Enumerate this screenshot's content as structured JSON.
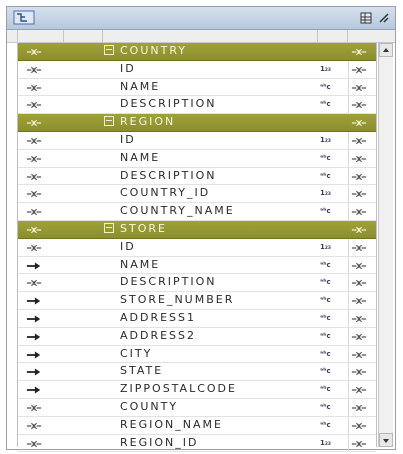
{
  "groups": [
    {
      "name": "COUNTRY",
      "fields": [
        {
          "name": "ID",
          "type": "num",
          "dir": "link"
        },
        {
          "name": "NAME",
          "type": "str",
          "dir": "link"
        },
        {
          "name": "DESCRIPTION",
          "type": "str",
          "dir": "link"
        }
      ]
    },
    {
      "name": "REGION",
      "fields": [
        {
          "name": "ID",
          "type": "num",
          "dir": "link"
        },
        {
          "name": "NAME",
          "type": "str",
          "dir": "link"
        },
        {
          "name": "DESCRIPTION",
          "type": "str",
          "dir": "link"
        },
        {
          "name": "COUNTRY_ID",
          "type": "num",
          "dir": "link"
        },
        {
          "name": "COUNTRY_NAME",
          "type": "str",
          "dir": "link"
        }
      ]
    },
    {
      "name": "STORE",
      "fields": [
        {
          "name": "ID",
          "type": "num",
          "dir": "link"
        },
        {
          "name": "NAME",
          "type": "str",
          "dir": "in"
        },
        {
          "name": "DESCRIPTION",
          "type": "str",
          "dir": "link"
        },
        {
          "name": "STORE_NUMBER",
          "type": "str",
          "dir": "in"
        },
        {
          "name": "ADDRESS1",
          "type": "str",
          "dir": "in"
        },
        {
          "name": "ADDRESS2",
          "type": "str",
          "dir": "in"
        },
        {
          "name": "CITY",
          "type": "str",
          "dir": "in"
        },
        {
          "name": "STATE",
          "type": "str",
          "dir": "in"
        },
        {
          "name": "ZIPPOSTALCODE",
          "type": "str",
          "dir": "in"
        },
        {
          "name": "COUNTY",
          "type": "str",
          "dir": "link"
        },
        {
          "name": "REGION_NAME",
          "type": "str",
          "dir": "link"
        },
        {
          "name": "REGION_ID",
          "type": "num",
          "dir": "link"
        }
      ]
    }
  ],
  "type_labels": {
    "num": "1₂₃",
    "str": "ᵃᵇc"
  },
  "colors": {
    "group_bg": "#9a9d35",
    "group_text": "#f8f8e0",
    "arrow": "#555555",
    "arrow_in": "#222222"
  }
}
